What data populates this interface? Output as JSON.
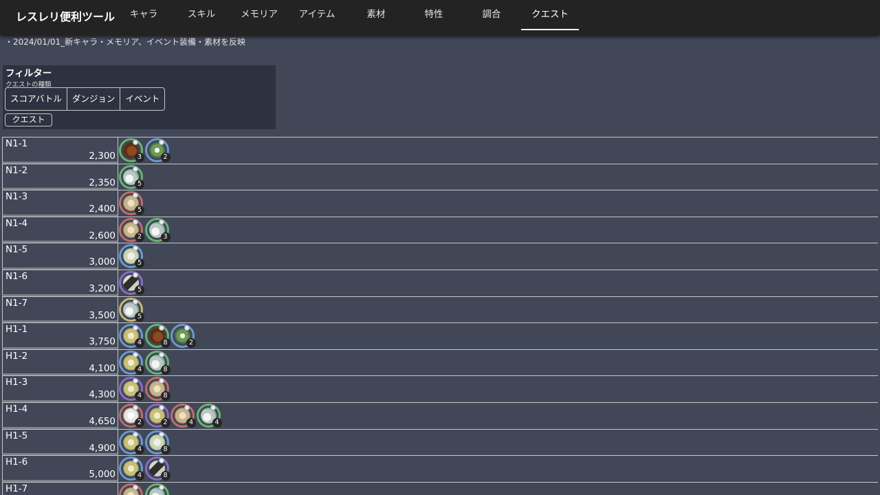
{
  "app": {
    "title": "レスレリ便利ツール"
  },
  "nav": {
    "tabs": [
      {
        "label": "キャラ"
      },
      {
        "label": "スキル"
      },
      {
        "label": "メモリア"
      },
      {
        "label": "アイテム"
      },
      {
        "label": "素材"
      },
      {
        "label": "特性"
      },
      {
        "label": "調合"
      },
      {
        "label": "クエスト",
        "active": true
      }
    ]
  },
  "notice": "・2024/01/01_新キャラ・メモリア、イベント装備・素材を反映",
  "filter": {
    "title": "フィルター",
    "subtitle": "クエストの種類",
    "types": [
      "スコアバトル",
      "ダンジョン",
      "イベント"
    ],
    "quest_button": "クエスト"
  },
  "colors": {
    "ring_blue": "#6a9ad0",
    "ring_green": "#64b86c",
    "ring_red": "#c26d6a",
    "ring_purple": "#8c6bc4",
    "ring_yellow": "#c8b873",
    "background": "#414757",
    "topbar": "#232323"
  },
  "quests": [
    {
      "name": "N1-1",
      "score": "2,300",
      "drops": [
        {
          "material": "brown-fur",
          "ring": "green",
          "count": "3"
        },
        {
          "material": "herb-leaves",
          "ring": "blue",
          "count": "2"
        }
      ]
    },
    {
      "name": "N1-2",
      "score": "2,350",
      "drops": [
        {
          "material": "pale-leaf",
          "ring": "green",
          "count": "5"
        }
      ]
    },
    {
      "name": "N1-3",
      "score": "2,400",
      "drops": [
        {
          "material": "grain",
          "ring": "red",
          "count": "5"
        }
      ]
    },
    {
      "name": "N1-4",
      "score": "2,600",
      "drops": [
        {
          "material": "grain",
          "ring": "red",
          "count": "2"
        },
        {
          "material": "pale-leaf",
          "ring": "green",
          "count": "3"
        }
      ]
    },
    {
      "name": "N1-5",
      "score": "3,000",
      "drops": [
        {
          "material": "pale-crystal",
          "ring": "blue",
          "count": "5"
        }
      ]
    },
    {
      "name": "N1-6",
      "score": "3,200",
      "drops": [
        {
          "material": "dark-branch",
          "ring": "purple",
          "count": "5"
        }
      ]
    },
    {
      "name": "N1-7",
      "score": "3,500",
      "drops": [
        {
          "material": "pale-leaf",
          "ring": "yellow",
          "count": "5"
        }
      ]
    },
    {
      "name": "H1-1",
      "score": "3,750",
      "drops": [
        {
          "material": "yellow-herb",
          "ring": "blue",
          "count": "4"
        },
        {
          "material": "brown-fur",
          "ring": "green",
          "count": "8"
        },
        {
          "material": "herb-leaves",
          "ring": "blue",
          "count": "2"
        }
      ]
    },
    {
      "name": "H1-2",
      "score": "4,100",
      "drops": [
        {
          "material": "yellow-herb",
          "ring": "blue",
          "count": "4"
        },
        {
          "material": "pale-leaf",
          "ring": "green",
          "count": "8"
        }
      ]
    },
    {
      "name": "H1-3",
      "score": "4,300",
      "drops": [
        {
          "material": "yellow-herb",
          "ring": "purple",
          "count": "4"
        },
        {
          "material": "grain",
          "ring": "red",
          "count": "8"
        }
      ]
    },
    {
      "name": "H1-4",
      "score": "4,650",
      "drops": [
        {
          "material": "white-flower",
          "ring": "red",
          "count": "2"
        },
        {
          "material": "yellow-herb",
          "ring": "purple",
          "count": "2"
        },
        {
          "material": "grain",
          "ring": "red",
          "count": "4"
        },
        {
          "material": "pale-leaf",
          "ring": "green",
          "count": "4"
        }
      ]
    },
    {
      "name": "H1-5",
      "score": "4,900",
      "drops": [
        {
          "material": "yellow-herb",
          "ring": "blue",
          "count": "4"
        },
        {
          "material": "pale-crystal",
          "ring": "blue",
          "count": "8"
        }
      ]
    },
    {
      "name": "H1-6",
      "score": "5,000",
      "drops": [
        {
          "material": "yellow-herb",
          "ring": "blue",
          "count": "4"
        },
        {
          "material": "dark-branch",
          "ring": "purple",
          "count": "8"
        }
      ]
    },
    {
      "name": "H1-7",
      "score": "",
      "drops": [
        {
          "material": "grain",
          "ring": "red",
          "count": ""
        },
        {
          "material": "pale-leaf",
          "ring": "green",
          "count": ""
        }
      ]
    }
  ]
}
